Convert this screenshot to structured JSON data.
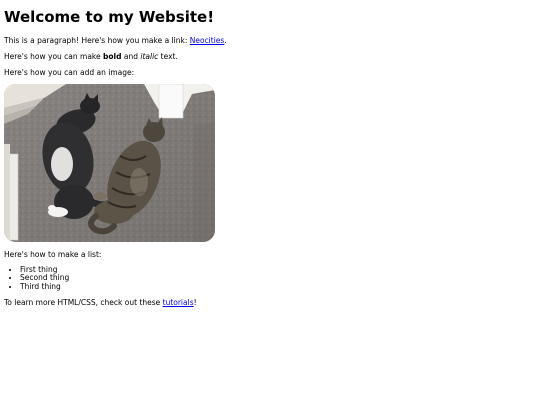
{
  "heading": "Welcome to my Website!",
  "intro": {
    "before_link": "This is a paragraph! Here's how you make a link: ",
    "link_text": "Neocities",
    "after_link": "."
  },
  "emphasis": {
    "before_bold": "Here's how you can make ",
    "bold_text": "bold",
    "middle": " and ",
    "italic_text": "italic",
    "after_italic": " text."
  },
  "image_caption": "Here's how you can add an image:",
  "image": {
    "subject_icon": "cats-photo",
    "colors": {
      "carpet": "#8f8a87",
      "stair": "#ece8e0",
      "wall": "#f4f4f4",
      "black_cat": "#2a2a2c",
      "tabby_cat": "#5a5246"
    }
  },
  "list_intro": "Here's how to make a list:",
  "list_items": [
    "First thing",
    "Second thing",
    "Third thing"
  ],
  "outro": {
    "before_link": "To learn more HTML/CSS, check out these ",
    "link_text": "tutorials",
    "after_link": "!"
  },
  "colors": {
    "link": "#0000ee",
    "text": "#000000",
    "background": "#ffffff"
  }
}
